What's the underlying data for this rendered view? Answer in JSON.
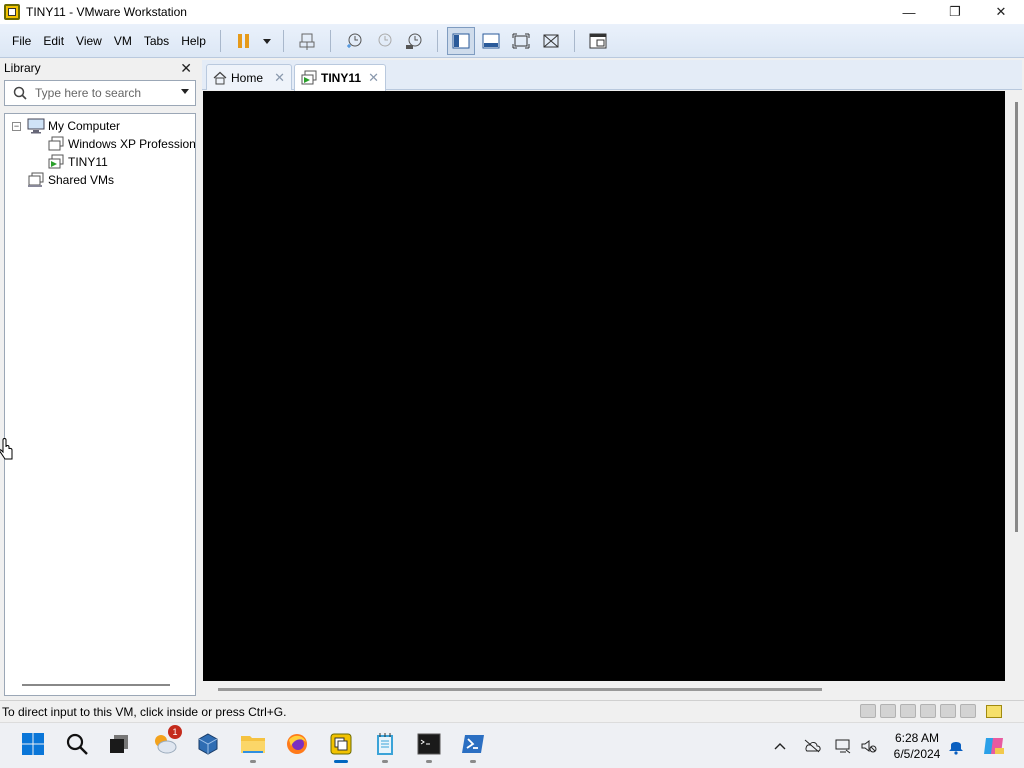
{
  "window": {
    "title": "TINY11 - VMware Workstation",
    "minimize": "—",
    "maximize": "❐",
    "close": "✕"
  },
  "menu": [
    "File",
    "Edit",
    "View",
    "VM",
    "Tabs",
    "Help"
  ],
  "library": {
    "title": "Library",
    "search_placeholder": "Type here to search",
    "tree": [
      {
        "label": "My Computer",
        "expanded": true
      },
      {
        "label": "Windows XP Professional"
      },
      {
        "label": "TINY11",
        "selected": true
      },
      {
        "label": "Shared VMs"
      }
    ]
  },
  "tabs": [
    {
      "label": "Home",
      "icon": "home-icon"
    },
    {
      "label": "TINY11",
      "icon": "vm-running-icon",
      "active": true
    }
  ],
  "status": {
    "text": "To direct input to this VM, click inside or press Ctrl+G."
  },
  "taskbar": {
    "apps": [
      "start",
      "search",
      "task-view",
      "weather",
      "virtualbox",
      "file-explorer",
      "firefox",
      "vmware",
      "notepad",
      "terminal",
      "powershell"
    ],
    "weather_badge": "1",
    "time": "6:28 AM",
    "date": "6/5/2024"
  },
  "colors": {
    "accent": "#0067c0",
    "console": "#000000",
    "toolbar": "#dce7f5"
  }
}
